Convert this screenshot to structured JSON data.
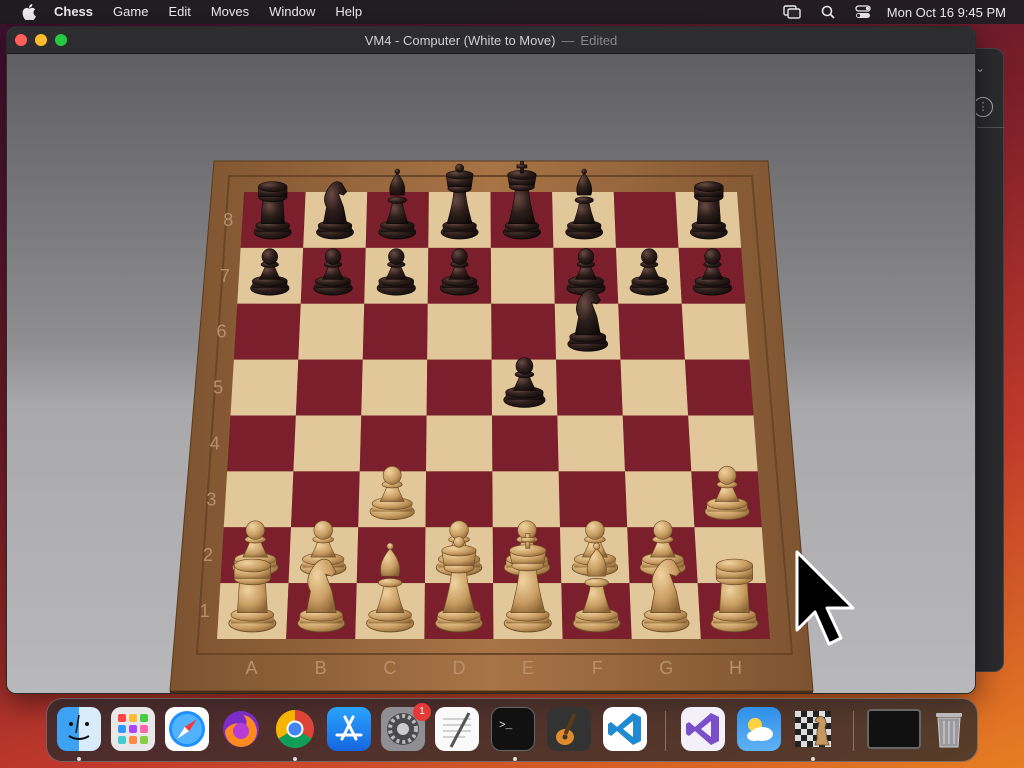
{
  "menubar": {
    "app_name": "Chess",
    "items": [
      "Game",
      "Edit",
      "Moves",
      "Window",
      "Help"
    ],
    "clock": "Mon Oct 16  9:45 PM"
  },
  "window": {
    "title": "VM4 - Computer   (White to Move)",
    "separator": "—",
    "edited": "Edited"
  },
  "board": {
    "files": [
      "A",
      "B",
      "C",
      "D",
      "E",
      "F",
      "G",
      "H"
    ],
    "ranks": [
      "1",
      "2",
      "3",
      "4",
      "5",
      "6",
      "7",
      "8"
    ],
    "pieces": [
      {
        "sq": "a8",
        "p": "rook",
        "c": "black"
      },
      {
        "sq": "b8",
        "p": "knight",
        "c": "black"
      },
      {
        "sq": "c8",
        "p": "bishop",
        "c": "black"
      },
      {
        "sq": "d8",
        "p": "queen",
        "c": "black"
      },
      {
        "sq": "e8",
        "p": "king",
        "c": "black"
      },
      {
        "sq": "f8",
        "p": "bishop",
        "c": "black"
      },
      {
        "sq": "h8",
        "p": "rook",
        "c": "black"
      },
      {
        "sq": "a7",
        "p": "pawn",
        "c": "black"
      },
      {
        "sq": "b7",
        "p": "pawn",
        "c": "black"
      },
      {
        "sq": "c7",
        "p": "pawn",
        "c": "black"
      },
      {
        "sq": "d7",
        "p": "pawn",
        "c": "black"
      },
      {
        "sq": "f7",
        "p": "pawn",
        "c": "black"
      },
      {
        "sq": "g7",
        "p": "pawn",
        "c": "black"
      },
      {
        "sq": "h7",
        "p": "pawn",
        "c": "black"
      },
      {
        "sq": "f6",
        "p": "knight",
        "c": "black"
      },
      {
        "sq": "e5",
        "p": "pawn",
        "c": "black"
      },
      {
        "sq": "c3",
        "p": "pawn",
        "c": "white"
      },
      {
        "sq": "h3",
        "p": "pawn",
        "c": "white"
      },
      {
        "sq": "a2",
        "p": "pawn",
        "c": "white"
      },
      {
        "sq": "b2",
        "p": "pawn",
        "c": "white"
      },
      {
        "sq": "d2",
        "p": "pawn",
        "c": "white"
      },
      {
        "sq": "e2",
        "p": "pawn",
        "c": "white"
      },
      {
        "sq": "f2",
        "p": "pawn",
        "c": "white"
      },
      {
        "sq": "g2",
        "p": "pawn",
        "c": "white"
      },
      {
        "sq": "a1",
        "p": "rook",
        "c": "white"
      },
      {
        "sq": "b1",
        "p": "knight",
        "c": "white"
      },
      {
        "sq": "c1",
        "p": "bishop",
        "c": "white"
      },
      {
        "sq": "d1",
        "p": "queen",
        "c": "white"
      },
      {
        "sq": "e1",
        "p": "king",
        "c": "white"
      },
      {
        "sq": "f1",
        "p": "bishop",
        "c": "white"
      },
      {
        "sq": "g1",
        "p": "knight",
        "c": "white"
      },
      {
        "sq": "h1",
        "p": "rook",
        "c": "white"
      }
    ],
    "colors": {
      "light_square": "#e2c79a",
      "dark_square": "#7a1f2b",
      "frame": "#9c6b3f",
      "white_piece": "#c9a36b",
      "black_piece": "#2a1c1a"
    }
  },
  "dock": {
    "apps": [
      {
        "name": "Finder",
        "icon": "finder-icon",
        "running": true
      },
      {
        "name": "Launchpad",
        "icon": "launchpad-icon",
        "running": false
      },
      {
        "name": "Safari",
        "icon": "safari-icon",
        "running": false
      },
      {
        "name": "Firefox",
        "icon": "firefox-icon",
        "running": false
      },
      {
        "name": "Chrome",
        "icon": "chrome-icon",
        "running": true
      },
      {
        "name": "App Store",
        "icon": "app-store-icon",
        "running": false
      },
      {
        "name": "System Settings",
        "icon": "settings-icon",
        "running": false,
        "badge": "1"
      },
      {
        "name": "TextEdit",
        "icon": "textedit-icon",
        "running": false
      },
      {
        "name": "Terminal",
        "icon": "terminal-icon",
        "running": true
      },
      {
        "name": "GarageBand",
        "icon": "garageband-icon",
        "running": false
      },
      {
        "name": "VS Code",
        "icon": "vscode-icon",
        "running": false
      },
      {
        "name": "Visual Studio",
        "icon": "visual-studio-icon",
        "running": false
      },
      {
        "name": "Weather",
        "icon": "weather-icon",
        "running": false
      },
      {
        "name": "Chess",
        "icon": "chess-icon",
        "running": true
      },
      {
        "name": "Window Preview",
        "icon": "window-preview-icon",
        "running": false
      },
      {
        "name": "Trash",
        "icon": "trash-icon",
        "running": false
      }
    ]
  }
}
